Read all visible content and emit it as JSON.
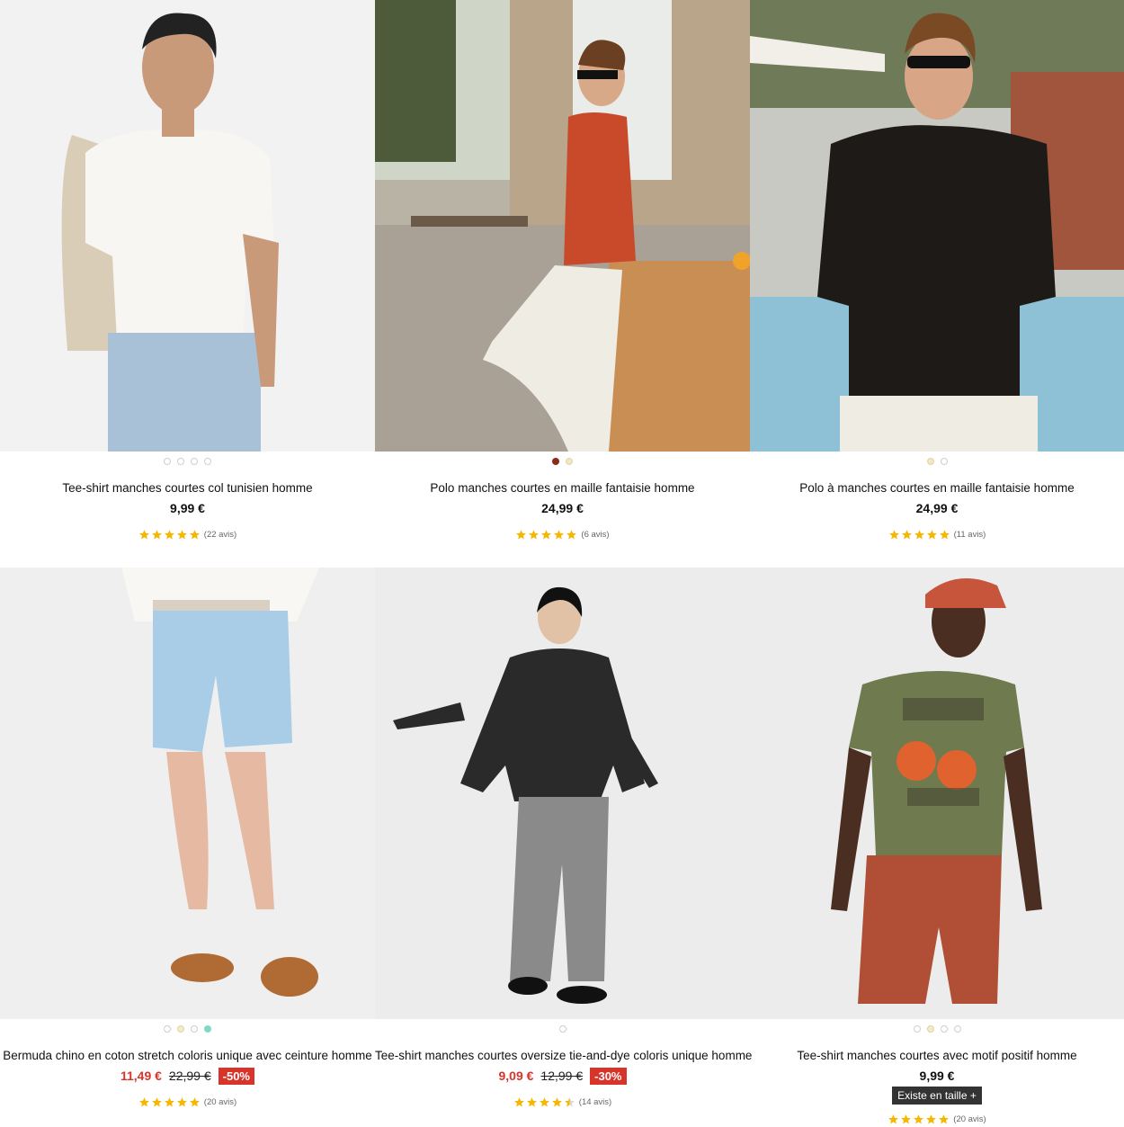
{
  "products": [
    {
      "title": "Tee-shirt manches courtes col tunisien homme",
      "price": "9,99 €",
      "reviews": "(22 avis)",
      "rating": 5,
      "swatches": [
        "#ffffff",
        "#ffffff",
        "#ffffff",
        "#ffffff"
      ]
    },
    {
      "title": "Polo manches courtes en maille fantaisie homme",
      "price": "24,99 €",
      "reviews": "(6 avis)",
      "rating": 5,
      "swatches": [
        "#8a2b1c",
        "#f3e7c2"
      ]
    },
    {
      "title": "Polo à manches courtes en maille fantaisie homme",
      "price": "24,99 €",
      "reviews": "(11 avis)",
      "rating": 5,
      "swatches": [
        "#f3e7c2",
        "#ffffff"
      ]
    },
    {
      "title": "Bermuda chino en coton stretch coloris unique avec ceinture homme",
      "price": "11,49 €",
      "old_price": "22,99 €",
      "discount": "-50%",
      "reviews": "(20 avis)",
      "rating": 5,
      "swatches": [
        "#ffffff",
        "#f3ecc8",
        "#ffffff",
        "#7fd9c4"
      ]
    },
    {
      "title": "Tee-shirt manches courtes oversize tie-and-dye coloris unique homme",
      "price": "9,09 €",
      "old_price": "12,99 €",
      "discount": "-30%",
      "reviews": "(14 avis)",
      "rating": 4.5,
      "swatches": [
        "#ffffff"
      ]
    },
    {
      "title": "Tee-shirt manches courtes avec motif positif homme",
      "price": "9,99 €",
      "size_badge": "Existe en taille +",
      "reviews": "(20 avis)",
      "rating": 5,
      "swatches": [
        "#ffffff",
        "#f3ecc8",
        "#ffffff",
        "#ffffff"
      ]
    }
  ],
  "colors": {
    "sale_red": "#d8342a",
    "star_gold": "#f5b700"
  }
}
